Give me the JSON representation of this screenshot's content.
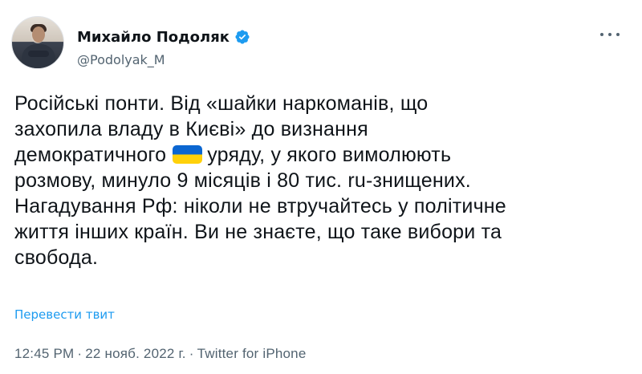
{
  "author": {
    "name": "Михайло Подоляк",
    "handle": "@Podolyak_M"
  },
  "tweet": {
    "line1": "Російські понти. Від «шайки наркоманів, що",
    "line2": "захопила владу в Києві» до визнання",
    "line3_before_flag": "демократичного",
    "line3_after_flag": "уряду, у якого вимолюють",
    "line4": "розмову, минуло 9 місяців і 80 тис. ru-знищених.",
    "line5": "Нагадування Рф: ніколи не втручайтесь у політичне",
    "line6": "життя інших країн. Ви не знаєте, що таке вибори та",
    "line7": "свобода."
  },
  "translate_label": "Перевести твит",
  "meta": {
    "time": "12:45 PM",
    "separator": "·",
    "date": "22 нояб. 2022 г.",
    "source": "Twitter for iPhone"
  },
  "icons": {
    "verified": "verified-badge-icon",
    "more": "more-options-icon",
    "flag": "ukraine-flag-icon"
  },
  "colors": {
    "text": "#0f1419",
    "secondary": "#536471",
    "link": "#1d9bf0",
    "flag_blue": "#0b66d1",
    "flag_yellow": "#ffd10a"
  }
}
